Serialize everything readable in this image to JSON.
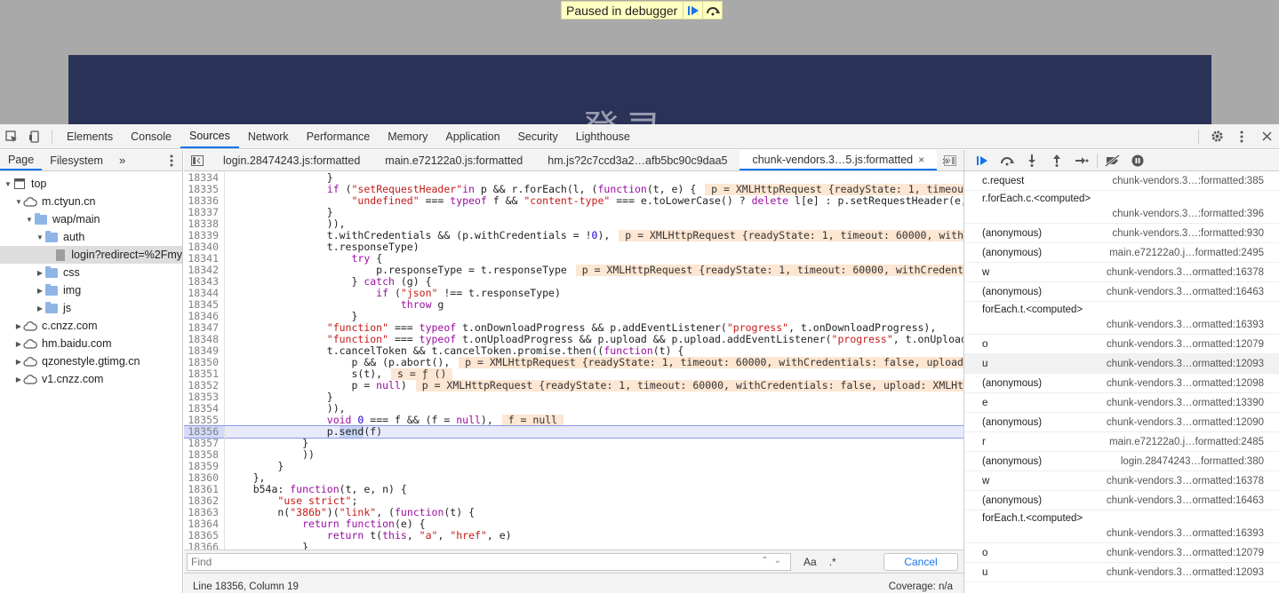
{
  "banner": {
    "text": "Paused in debugger"
  },
  "site": {
    "title": "登录"
  },
  "main_tabs": [
    "Elements",
    "Console",
    "Sources",
    "Network",
    "Performance",
    "Memory",
    "Application",
    "Security",
    "Lighthouse"
  ],
  "active_main_tab": "Sources",
  "nav": {
    "tabs": [
      "Page",
      "Filesystem"
    ],
    "tree": [
      {
        "label": "top",
        "arrow": "▼",
        "icon": "file-square",
        "level": 0
      },
      {
        "label": "m.ctyun.cn",
        "arrow": "▼",
        "icon": "cloud",
        "level": 1
      },
      {
        "label": "wap/main",
        "arrow": "▼",
        "icon": "folder",
        "level": 2
      },
      {
        "label": "auth",
        "arrow": "▼",
        "icon": "folder",
        "level": 3
      },
      {
        "label": "login?redirect=%2Fmy",
        "arrow": "",
        "icon": "file",
        "level": 4,
        "selected": true
      },
      {
        "label": "css",
        "arrow": "▶",
        "icon": "folder",
        "level": 3
      },
      {
        "label": "img",
        "arrow": "▶",
        "icon": "folder",
        "level": 3
      },
      {
        "label": "js",
        "arrow": "▶",
        "icon": "folder",
        "level": 3
      },
      {
        "label": "c.cnzz.com",
        "arrow": "▶",
        "icon": "cloud",
        "level": 1
      },
      {
        "label": "hm.baidu.com",
        "arrow": "▶",
        "icon": "cloud",
        "level": 1
      },
      {
        "label": "qzonestyle.gtimg.cn",
        "arrow": "▶",
        "icon": "cloud",
        "level": 1
      },
      {
        "label": "v1.cnzz.com",
        "arrow": "▶",
        "icon": "cloud",
        "level": 1
      }
    ]
  },
  "file_tabs": [
    "login.28474243.js:formatted",
    "main.e72122a0.js:formatted",
    "hm.js?2c7ccd3a2…afb5bc90c9daa5",
    "chunk-vendors.3…5.js:formatted"
  ],
  "code_lines": [
    {
      "n": "18334",
      "html": "                }"
    },
    {
      "n": "18335",
      "html": "                <span class=\"kw\">if</span> (<span class=\"str\">\"setRequestHeader\"</span><span class=\"kw\">in</span> p && r.forEach(l, (<span class=\"kw\">function</span>(t, e) {<span class=\"inl\"> p = XMLHttpRequest {readyState: 1, timeout: 60000, withCredentials: false, upload: XMLHttpRequestUpload</span>"
    },
    {
      "n": "18336",
      "html": "                    <span class=\"str\">\"undefined\"</span> === <span class=\"kw\">typeof</span> f && <span class=\"str\">\"content-type\"</span> === e.toLowerCase() ? <span class=\"kw\">delete</span> l[e] : p.setRequestHeader(e, t)"
    },
    {
      "n": "18337",
      "html": "                }"
    },
    {
      "n": "18338",
      "html": "                )),"
    },
    {
      "n": "18339",
      "html": "                t.withCredentials && (p.withCredentials = !<span class=\"ident\">0</span>),<span class=\"inl\"> p = XMLHttpRequest {readyState: 1, timeout: 60000, withCredentials: false</span>"
    },
    {
      "n": "18340",
      "html": "                t.responseType)"
    },
    {
      "n": "18341",
      "html": "                    <span class=\"kw\">try</span> {"
    },
    {
      "n": "18342",
      "html": "                        p.responseType = t.responseType<span class=\"inl\"> p = XMLHttpRequest {readyState: 1, timeout: 60000, withCredentials: false</span>"
    },
    {
      "n": "18343",
      "html": "                    } <span class=\"kw\">catch</span> (g) {"
    },
    {
      "n": "18344",
      "html": "                        <span class=\"kw\">if</span> (<span class=\"str\">\"json\"</span> !== t.responseType)"
    },
    {
      "n": "18345",
      "html": "                            <span class=\"kw\">throw</span> g"
    },
    {
      "n": "18346",
      "html": "                    }"
    },
    {
      "n": "18347",
      "html": "                <span class=\"str\">\"function\"</span> === <span class=\"kw\">typeof</span> t.onDownloadProgress && p.addEventListener(<span class=\"str\">\"progress\"</span>, t.onDownloadProgress),"
    },
    {
      "n": "18348",
      "html": "                <span class=\"str\">\"function\"</span> === <span class=\"kw\">typeof</span> t.onUploadProgress && p.upload && p.upload.addEventListener(<span class=\"str\">\"progress\"</span>, t.onUploadProgress),"
    },
    {
      "n": "18349",
      "html": "                t.cancelToken && t.cancelToken.promise.then((<span class=\"kw\">function</span>(t) {"
    },
    {
      "n": "18350",
      "html": "                    p && (p.abort(),<span class=\"inl\"> p = XMLHttpRequest {readyState: 1, timeout: 60000, withCredentials: false, upload: XMLHttpRequestUpload</span>"
    },
    {
      "n": "18351",
      "html": "                    s(t),<span class=\"inl\"> s = ƒ () </span>"
    },
    {
      "n": "18352",
      "html": "                    p = <span class=\"kw\">null</span>)<span class=\"inl\"> p = XMLHttpRequest {readyState: 1, timeout: 60000, withCredentials: false, upload: XMLHttpRequestUpload</span>"
    },
    {
      "n": "18353",
      "html": "                }"
    },
    {
      "n": "18354",
      "html": "                )),"
    },
    {
      "n": "18355",
      "html": "                <span class=\"kw\">void</span> <span class=\"ident\">0</span> === f && (f = <span class=\"kw\">null</span>),<span class=\"inl\"> f = null </span>"
    },
    {
      "n": "18356",
      "html": "                p.<span class=\"selword\">send</span>(f)",
      "exec": true
    },
    {
      "n": "18357",
      "html": "            }"
    },
    {
      "n": "18358",
      "html": "            ))"
    },
    {
      "n": "18359",
      "html": "        }"
    },
    {
      "n": "18360",
      "html": "    },"
    },
    {
      "n": "18361",
      "html": "    b54a: <span class=\"kw\">function</span>(t, e, n) {"
    },
    {
      "n": "18362",
      "html": "        <span class=\"str\">\"use strict\"</span>;"
    },
    {
      "n": "18363",
      "html": "        n(<span class=\"str\">\"386b\"</span>)(<span class=\"str\">\"link\"</span>, (<span class=\"kw\">function</span>(t) {"
    },
    {
      "n": "18364",
      "html": "            <span class=\"kw\">return</span> <span class=\"kw\">function</span>(e) {"
    },
    {
      "n": "18365",
      "html": "                <span class=\"kw\">return</span> t(<span class=\"kw\">this</span>, <span class=\"str\">\"a\"</span>, <span class=\"str\">\"href\"</span>, e)"
    },
    {
      "n": "18366",
      "html": "            }"
    }
  ],
  "find": {
    "placeholder": "Find",
    "match_case": "Aa",
    "regex": ".*",
    "cancel": "Cancel"
  },
  "status": {
    "position": "Line 18356, Column 19",
    "coverage": "Coverage: n/a"
  },
  "call_stack": [
    {
      "fn": "c.request",
      "loc": "chunk-vendors.3…:formatted:385"
    },
    {
      "fn": "r.forEach.c.<computed>",
      "loc": "chunk-vendors.3…:formatted:396",
      "two": true
    },
    {
      "fn": "(anonymous)",
      "loc": "chunk-vendors.3…:formatted:930"
    },
    {
      "fn": "(anonymous)",
      "loc": "main.e72122a0.j…formatted:2495"
    },
    {
      "fn": "w",
      "loc": "chunk-vendors.3…ormatted:16378"
    },
    {
      "fn": "(anonymous)",
      "loc": "chunk-vendors.3…ormatted:16463"
    },
    {
      "fn": "forEach.t.<computed>",
      "loc": "chunk-vendors.3…ormatted:16393",
      "two": true
    },
    {
      "fn": "o",
      "loc": "chunk-vendors.3…ormatted:12079"
    },
    {
      "fn": "u",
      "loc": "chunk-vendors.3…ormatted:12093",
      "selected": true
    },
    {
      "fn": "(anonymous)",
      "loc": "chunk-vendors.3…ormatted:12098"
    },
    {
      "fn": "e",
      "loc": "chunk-vendors.3…ormatted:13390"
    },
    {
      "fn": "(anonymous)",
      "loc": "chunk-vendors.3…ormatted:12090"
    },
    {
      "fn": "r",
      "loc": "main.e72122a0.j…formatted:2485"
    },
    {
      "fn": "(anonymous)",
      "loc": "login.28474243…formatted:380"
    },
    {
      "fn": "w",
      "loc": "chunk-vendors.3…ormatted:16378"
    },
    {
      "fn": "(anonymous)",
      "loc": "chunk-vendors.3…ormatted:16463"
    },
    {
      "fn": "forEach.t.<computed>",
      "loc": "chunk-vendors.3…ormatted:16393",
      "two": true
    },
    {
      "fn": "o",
      "loc": "chunk-vendors.3…ormatted:12079"
    },
    {
      "fn": "u",
      "loc": "chunk-vendors.3…ormatted:12093"
    }
  ],
  "colors": {
    "accent": "#1a73e8",
    "exec_line": "#e8eafc",
    "inline_value": "#fde6d2",
    "page_header": "#2b3258"
  }
}
